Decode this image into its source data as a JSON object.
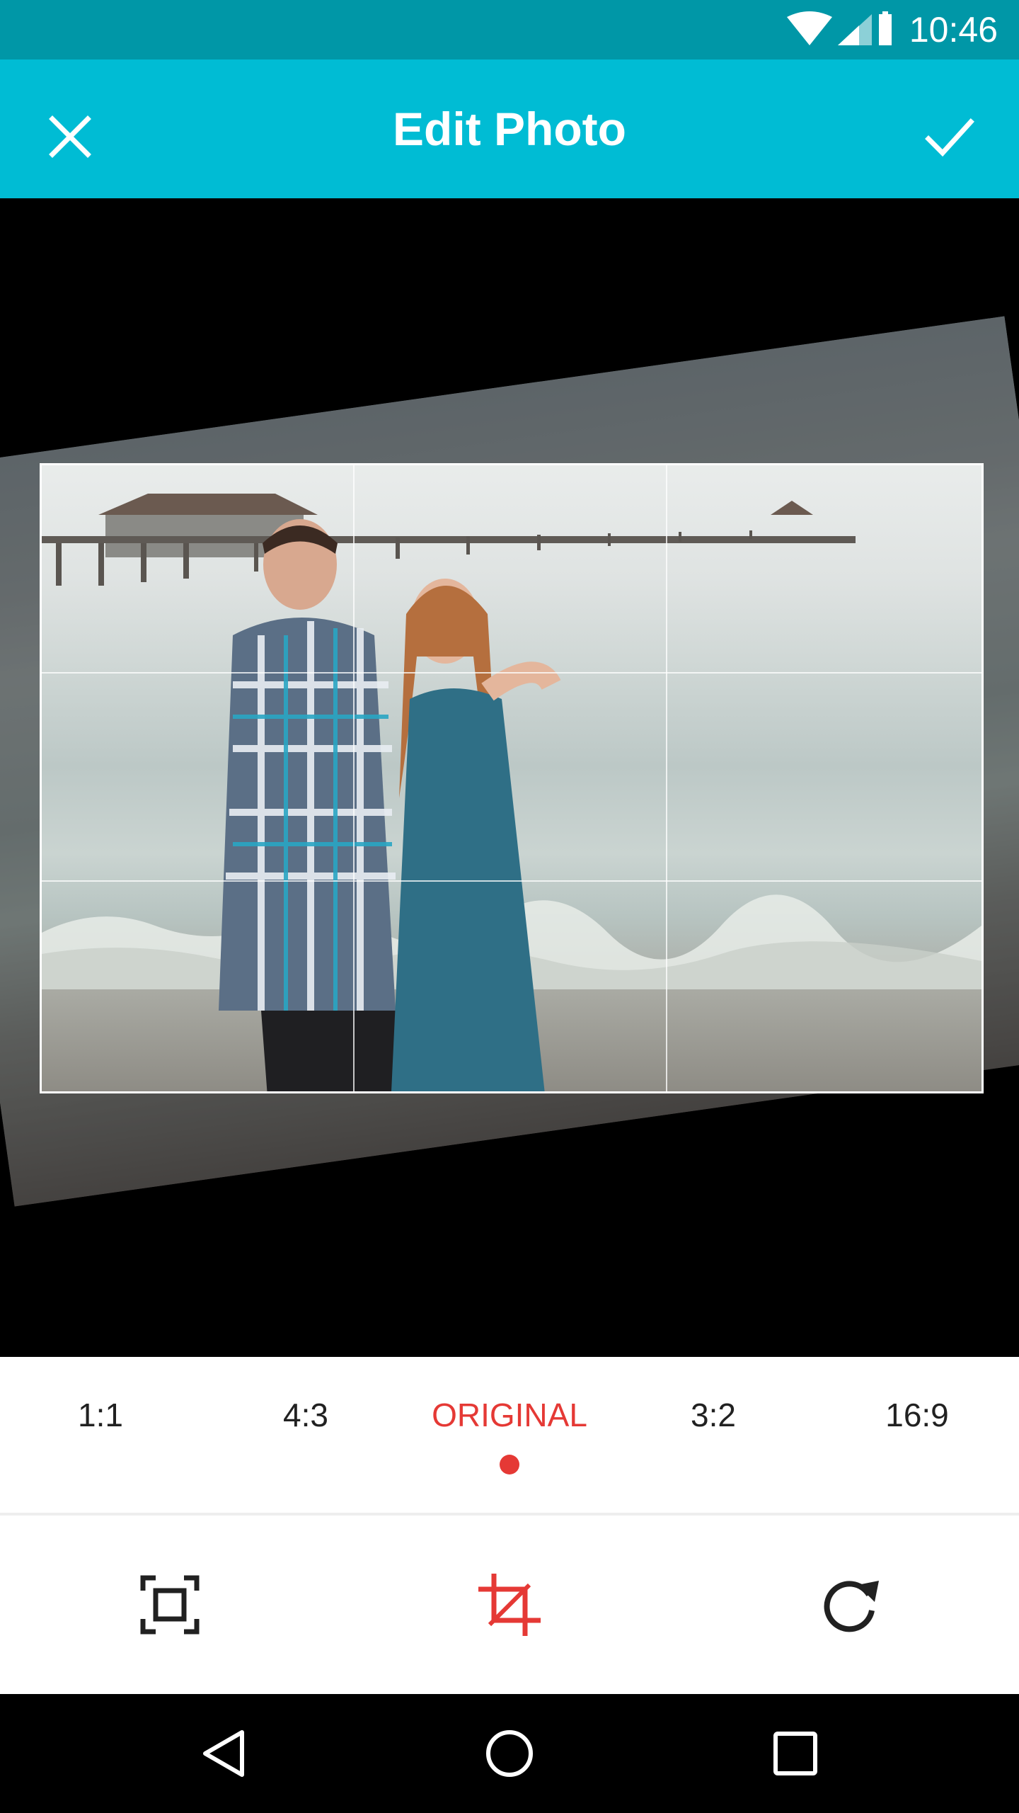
{
  "status_bar": {
    "time": "10:46",
    "icons": [
      "wifi-icon",
      "signal-icon",
      "battery-icon"
    ]
  },
  "app_bar": {
    "title": "Edit Photo",
    "close_icon": "close-icon",
    "confirm_icon": "check-icon",
    "color": "#00bcd4"
  },
  "aspect_ratios": {
    "items": [
      "1:1",
      "4:3",
      "ORIGINAL",
      "3:2",
      "16:9"
    ],
    "selected": "ORIGINAL",
    "accent": "#e53935"
  },
  "tools": [
    "fit-icon",
    "crop-icon",
    "rotate-icon"
  ],
  "nav": [
    "back-icon",
    "home-icon",
    "recents-icon"
  ]
}
